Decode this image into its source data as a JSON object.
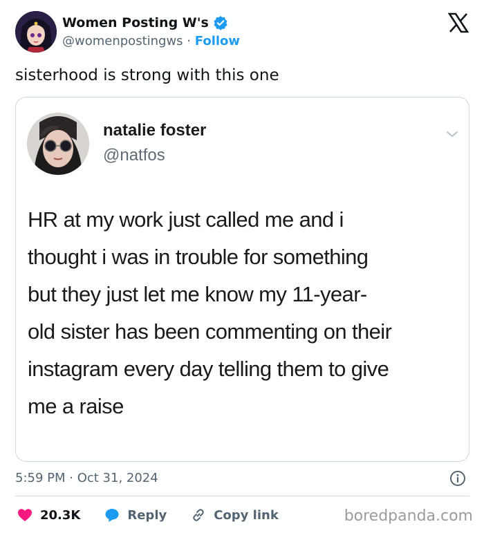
{
  "author": {
    "display_name": "Women Posting W's",
    "handle": "@womenpostingws",
    "separator": "·",
    "follow_label": "Follow"
  },
  "tweet": {
    "text": "sisterhood is strong with this one",
    "timestamp": "5:59 PM · Oct 31, 2024"
  },
  "quoted": {
    "name": "natalie foster",
    "handle": "@natfos",
    "lines": [
      "HR at my work just called me and i",
      "thought i was in trouble for something",
      "but they just let me know my 11-year-",
      "old sister has been commenting on their",
      "instagram every day telling them to give",
      "me a raise"
    ]
  },
  "actions": {
    "likes": "20.3K",
    "reply_label": "Reply",
    "copy_link_label": "Copy link"
  },
  "watermark": "boredpanda.com",
  "colors": {
    "accent": "#1d9bf0",
    "like": "#f91880",
    "secondary_text": "#536471",
    "border": "#cfd9de"
  },
  "icons": [
    "verified-badge-icon",
    "x-logo-icon",
    "chevron-down-icon",
    "info-icon",
    "heart-icon",
    "reply-bubble-icon",
    "link-icon"
  ]
}
